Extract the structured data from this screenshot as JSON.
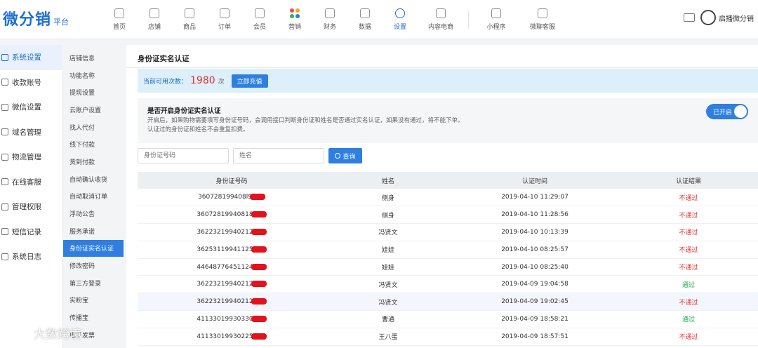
{
  "brand": {
    "logo": "微分销",
    "sub": "平台"
  },
  "nav": [
    {
      "label": "首页",
      "icon": "home-icon"
    },
    {
      "label": "店铺",
      "icon": "store-icon"
    },
    {
      "label": "商品",
      "icon": "goods-icon"
    },
    {
      "label": "订单",
      "icon": "order-icon"
    },
    {
      "label": "会员",
      "icon": "member-icon"
    },
    {
      "label": "营销",
      "icon": "marketing-icon"
    },
    {
      "label": "财务",
      "icon": "finance-icon"
    },
    {
      "label": "数据",
      "icon": "data-icon"
    },
    {
      "label": "设置",
      "icon": "settings-icon"
    },
    {
      "label": "内容电商",
      "icon": "content-icon"
    },
    {
      "label": "小程序",
      "icon": "miniapp-icon"
    },
    {
      "label": "微聊客服",
      "icon": "chat-icon"
    }
  ],
  "user": {
    "name": "启播微分销"
  },
  "side1": [
    {
      "label": "系统设置",
      "icon": "system-settings-icon"
    },
    {
      "label": "收款账号",
      "icon": "account-icon"
    },
    {
      "label": "微信设置",
      "icon": "wechat-icon"
    },
    {
      "label": "域名管理",
      "icon": "domain-icon"
    },
    {
      "label": "物流管理",
      "icon": "logistics-icon"
    },
    {
      "label": "在线客服",
      "icon": "service-icon"
    },
    {
      "label": "管理权限",
      "icon": "permission-icon"
    },
    {
      "label": "短信记录",
      "icon": "sms-icon"
    },
    {
      "label": "系统日志",
      "icon": "log-icon"
    }
  ],
  "side2": [
    "店铺信息",
    "功能名称",
    "提现设置",
    "云账户设置",
    "找人代付",
    "线下付款",
    "货到付款",
    "自动确认收货",
    "自动取消订单",
    "浮动公告",
    "服务承诺",
    "身份证实名认证",
    "修改密码",
    "第三方登录",
    "实粉宝",
    "传播宝",
    "电子发票"
  ],
  "page": {
    "title": "身份证实名认证",
    "quota_label": "当前可用次数：",
    "quota_count": "1980",
    "quota_unit": "次",
    "recharge": "立即充值",
    "setting_title": "是否开启身份证实名认证",
    "setting_desc1": "开启后，如果购物需要填写身份证号码，会调用接口判断身份证和姓名是否通过实名认证，如果没有通过，将不能下单。",
    "setting_desc2": "认证过的身份证和姓名不会重复扣费。",
    "toggle_label": "已开启",
    "id_placeholder": "身份证号码",
    "name_placeholder": "姓名",
    "search_label": "查询"
  },
  "table": {
    "headers": [
      "身份证号码",
      "姓名",
      "认证时间",
      "认证结果"
    ],
    "rows": [
      {
        "id": "360728199408l9",
        "name": "侧身",
        "time": "2019-04-10 11:29:07",
        "result": "不通过",
        "status": "fail"
      },
      {
        "id": "36072819940818",
        "name": "侧身",
        "time": "2019-04-10 11:28:56",
        "result": "不通过",
        "status": "fail"
      },
      {
        "id": "36223219940212",
        "name": "冯贤文",
        "time": "2019-04-10 10:13:39",
        "result": "不通过",
        "status": "fail"
      },
      {
        "id": "36253119941125",
        "name": "娃娃",
        "time": "2019-04-10 08:25:57",
        "result": "不通过",
        "status": "fail"
      },
      {
        "id": "44648776451124",
        "name": "娃娃",
        "time": "2019-04-10 08:25:40",
        "result": "不通过",
        "status": "fail"
      },
      {
        "id": "36223219940212",
        "name": "冯贤文",
        "time": "2019-04-09 19:04:58",
        "result": "通过",
        "status": "ok"
      },
      {
        "id": "36223219940212",
        "name": "冯贤文",
        "time": "2019-04-09 19:02:45",
        "result": "不通过",
        "status": "fail"
      },
      {
        "id": "41133019930330",
        "name": "曹通",
        "time": "2019-04-09 18:58:21",
        "result": "通过",
        "status": "ok"
      },
      {
        "id": "41133019930225",
        "name": "王八蛋",
        "time": "2019-04-09 18:57:51",
        "result": "不通过",
        "status": "fail"
      }
    ]
  },
  "watermark": "大数跨境",
  "colors": {
    "accent": "#2f7fe0",
    "fail": "#e0312f",
    "ok": "#1fa64a"
  }
}
